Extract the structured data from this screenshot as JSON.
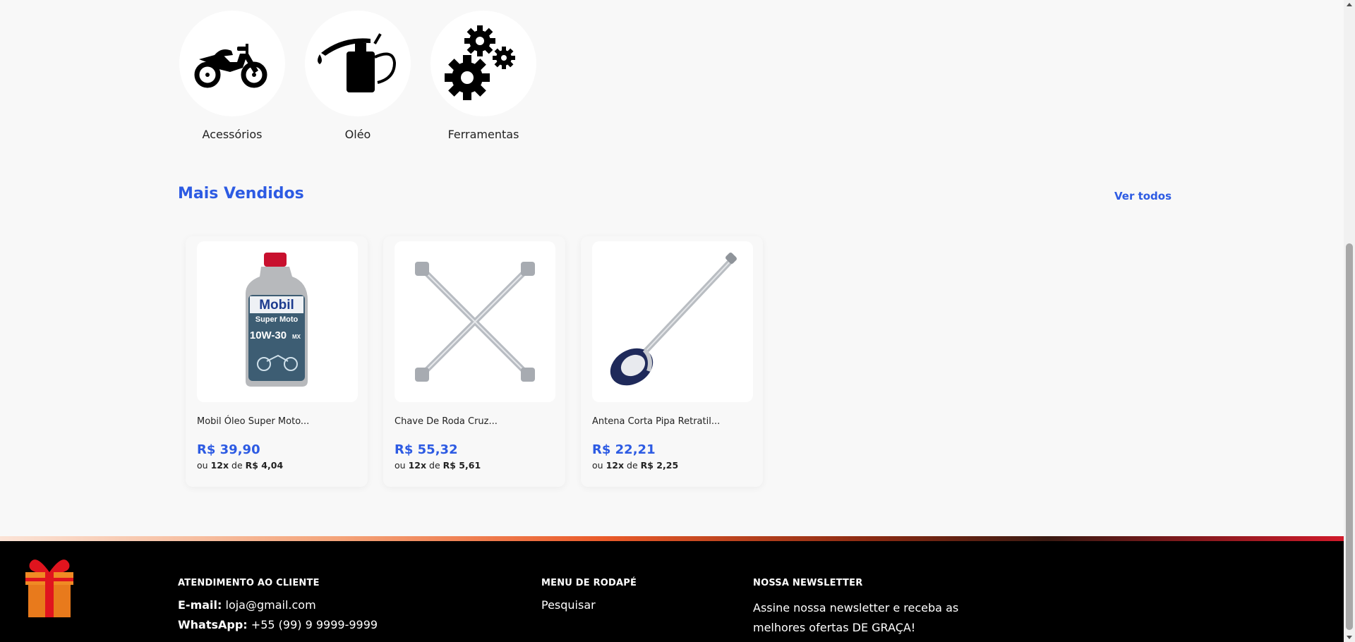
{
  "categories": [
    {
      "label": "Acessórios",
      "icon": "motorcycle-icon"
    },
    {
      "label": "Oléo",
      "icon": "oil-can-icon"
    },
    {
      "label": "Ferramentas",
      "icon": "gears-icon"
    }
  ],
  "best_sellers": {
    "title": "Mais Vendidos",
    "see_all": "Ver todos",
    "products": [
      {
        "name": "Mobil Óleo Super Moto...",
        "price": "R$ 39,90",
        "installment_prefix": "ou",
        "installment_count": "12x",
        "installment_mid": "de",
        "installment_value": "R$ 4,04",
        "image": "oil-bottle-image",
        "label": {
          "brand": "Mobil",
          "line": "Super Moto",
          "grade": "10W-30",
          "grade_suffix": "MX"
        }
      },
      {
        "name": "Chave De Roda Cruz...",
        "price": "R$ 55,32",
        "installment_prefix": "ou",
        "installment_count": "12x",
        "installment_mid": "de",
        "installment_value": "R$ 5,61",
        "image": "cross-wrench-image"
      },
      {
        "name": "Antena Corta Pipa Retratil...",
        "price": "R$ 22,21",
        "installment_prefix": "ou",
        "installment_count": "12x",
        "installment_mid": "de",
        "installment_value": "R$ 2,25",
        "image": "antenna-image"
      }
    ]
  },
  "footer": {
    "customer_service": {
      "title": "ATENDIMENTO AO CLIENTE",
      "email_label": "E-mail:",
      "email_value": "loja@gmail.com",
      "whatsapp_label": "WhatsApp:",
      "whatsapp_value": "+55 (99) 9 9999-9999"
    },
    "menu": {
      "title": "MENU DE RODAPÉ",
      "items": [
        "Pesquisar"
      ]
    },
    "newsletter": {
      "title": "NOSSA NEWSLETTER",
      "text": "Assine nossa newsletter e receba as melhores ofertas DE GRAÇA!"
    }
  },
  "colors": {
    "accent": "#2d5be3",
    "footer_bg": "#000000",
    "page_bg": "#f8f8f8"
  }
}
